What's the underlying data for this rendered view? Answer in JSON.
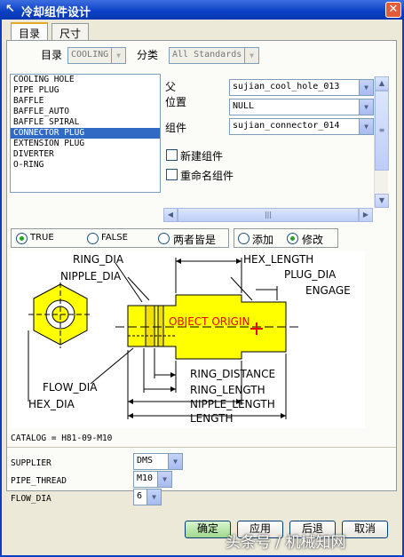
{
  "window": {
    "title": "冷却组件设计"
  },
  "tabs": [
    {
      "label": "目录"
    },
    {
      "label": "尺寸"
    }
  ],
  "catalog_row": {
    "catalog_label": "目录",
    "catalog_value": "COOLING",
    "category_label": "分类",
    "category_value": "All Standards"
  },
  "component_list": [
    "COOLING HOLE",
    "PIPE PLUG",
    "BAFFLE",
    "BAFFLE_AUTO",
    "BAFFLE SPIRAL",
    "CONNECTOR PLUG",
    "EXTENSION PLUG",
    "DIVERTER",
    "O-RING"
  ],
  "selected_component": "CONNECTOR PLUG",
  "fields": {
    "parent_label": "父",
    "parent_value": "sujian_cool_hole_013",
    "position_label": "位置",
    "position_value": "NULL",
    "component_label": "组件",
    "component_value": "sujian_connector_014"
  },
  "checkboxes": {
    "new_component": "新建组件",
    "rename_component": "重命名组件"
  },
  "radio_filter": {
    "true_label": "TRUE",
    "false_label": "FALSE",
    "both_label": "两者皆是",
    "selected": "TRUE"
  },
  "radio_mode": {
    "add_label": "添加",
    "modify_label": "修改",
    "selected": "修改"
  },
  "diagram": {
    "ring_dia": "RING_DIA",
    "nipple_dia": "NIPPLE_DIA",
    "hex_length": "HEX_LENGTH",
    "plug_dia": "PLUG_DIA",
    "engage": "ENGAGE",
    "object_origin": "OBJECT ORIGIN",
    "flow_dia": "FLOW_DIA",
    "hex_dia": "HEX_DIA",
    "ring_distance": "RING_DISTANCE",
    "ring_length": "RING_LENGTH",
    "nipple_length": "NIPPLE_LENGTH",
    "length": "LENGTH"
  },
  "catalog_code": "CATALOG = H81-09-M10",
  "params": [
    {
      "name": "SUPPLIER",
      "value": "DMS"
    },
    {
      "name": "PIPE_THREAD",
      "value": "M10"
    },
    {
      "name": "FLOW_DIA",
      "value": "6"
    }
  ],
  "buttons": {
    "ok": "确定",
    "apply": "应用",
    "back": "后退",
    "cancel": "取消"
  },
  "watermark": "头条号 / 机械知网",
  "colors": {
    "titlebar": "#0a3fc4",
    "selection": "#316ac5",
    "part_fill": "#ffff00",
    "origin": "#ff0000"
  }
}
